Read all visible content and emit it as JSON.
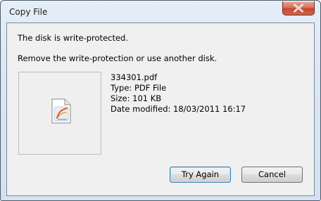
{
  "window": {
    "title": "Copy File"
  },
  "message": {
    "line1": "The disk is write-protected.",
    "line2": "Remove the write-protection or use another disk."
  },
  "file": {
    "icon": "pdf-file-icon",
    "name": "334301.pdf",
    "type": "Type: PDF File",
    "size": "Size: 101 KB",
    "modified": "Date modified: 18/03/2011 16:17"
  },
  "buttons": {
    "try_again": "Try Again",
    "cancel": "Cancel"
  },
  "colors": {
    "close_button": "#c7452c",
    "default_button_border": "#3c7fb1",
    "dialog_background": "#f0f0f0"
  }
}
